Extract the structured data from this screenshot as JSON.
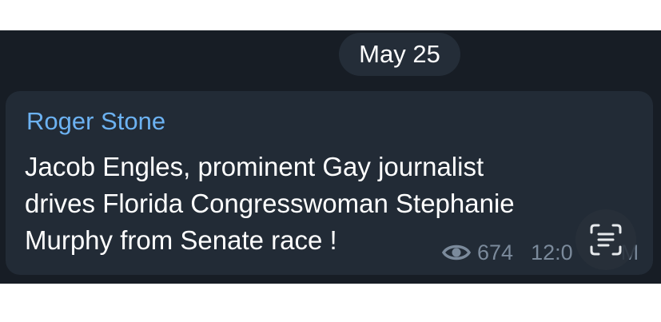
{
  "date_separator": {
    "label": "May 25"
  },
  "message": {
    "sender": "Roger Stone",
    "text_lines": [
      "Jacob Engles, prominent Gay journalist",
      "drives Florida Congresswoman Stephanie",
      "Murphy from Senate race !"
    ],
    "views": "674",
    "time": "12:0",
    "time_suffix": "M"
  },
  "icons": {
    "views": "eye-icon",
    "overlay_button": "text-scan-icon"
  },
  "colors": {
    "chat_background": "#171d25",
    "bubble_background": "#222b36",
    "date_pill_background": "#242d38",
    "sender_name": "#6cb2f2",
    "meta_text": "#7b8a9b",
    "message_text": "#ffffff"
  }
}
